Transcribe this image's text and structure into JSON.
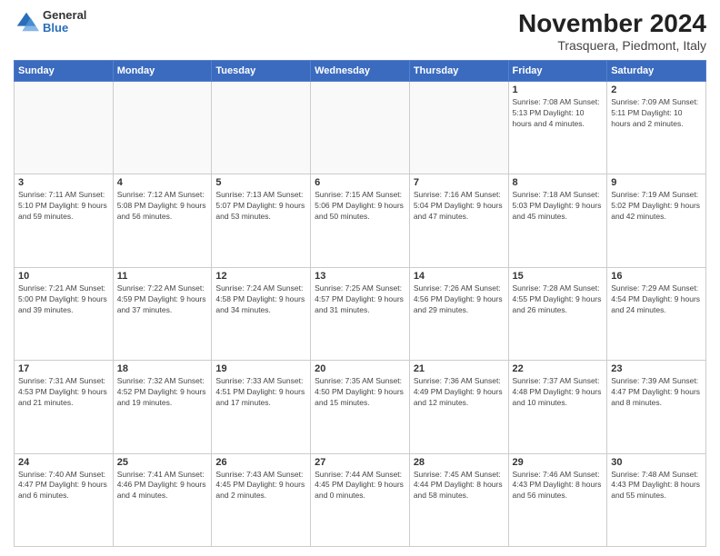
{
  "logo": {
    "general": "General",
    "blue": "Blue"
  },
  "title": "November 2024",
  "subtitle": "Trasquera, Piedmont, Italy",
  "days_of_week": [
    "Sunday",
    "Monday",
    "Tuesday",
    "Wednesday",
    "Thursday",
    "Friday",
    "Saturday"
  ],
  "weeks": [
    [
      {
        "day": "",
        "info": ""
      },
      {
        "day": "",
        "info": ""
      },
      {
        "day": "",
        "info": ""
      },
      {
        "day": "",
        "info": ""
      },
      {
        "day": "",
        "info": ""
      },
      {
        "day": "1",
        "info": "Sunrise: 7:08 AM\nSunset: 5:13 PM\nDaylight: 10 hours\nand 4 minutes."
      },
      {
        "day": "2",
        "info": "Sunrise: 7:09 AM\nSunset: 5:11 PM\nDaylight: 10 hours\nand 2 minutes."
      }
    ],
    [
      {
        "day": "3",
        "info": "Sunrise: 7:11 AM\nSunset: 5:10 PM\nDaylight: 9 hours\nand 59 minutes."
      },
      {
        "day": "4",
        "info": "Sunrise: 7:12 AM\nSunset: 5:08 PM\nDaylight: 9 hours\nand 56 minutes."
      },
      {
        "day": "5",
        "info": "Sunrise: 7:13 AM\nSunset: 5:07 PM\nDaylight: 9 hours\nand 53 minutes."
      },
      {
        "day": "6",
        "info": "Sunrise: 7:15 AM\nSunset: 5:06 PM\nDaylight: 9 hours\nand 50 minutes."
      },
      {
        "day": "7",
        "info": "Sunrise: 7:16 AM\nSunset: 5:04 PM\nDaylight: 9 hours\nand 47 minutes."
      },
      {
        "day": "8",
        "info": "Sunrise: 7:18 AM\nSunset: 5:03 PM\nDaylight: 9 hours\nand 45 minutes."
      },
      {
        "day": "9",
        "info": "Sunrise: 7:19 AM\nSunset: 5:02 PM\nDaylight: 9 hours\nand 42 minutes."
      }
    ],
    [
      {
        "day": "10",
        "info": "Sunrise: 7:21 AM\nSunset: 5:00 PM\nDaylight: 9 hours\nand 39 minutes."
      },
      {
        "day": "11",
        "info": "Sunrise: 7:22 AM\nSunset: 4:59 PM\nDaylight: 9 hours\nand 37 minutes."
      },
      {
        "day": "12",
        "info": "Sunrise: 7:24 AM\nSunset: 4:58 PM\nDaylight: 9 hours\nand 34 minutes."
      },
      {
        "day": "13",
        "info": "Sunrise: 7:25 AM\nSunset: 4:57 PM\nDaylight: 9 hours\nand 31 minutes."
      },
      {
        "day": "14",
        "info": "Sunrise: 7:26 AM\nSunset: 4:56 PM\nDaylight: 9 hours\nand 29 minutes."
      },
      {
        "day": "15",
        "info": "Sunrise: 7:28 AM\nSunset: 4:55 PM\nDaylight: 9 hours\nand 26 minutes."
      },
      {
        "day": "16",
        "info": "Sunrise: 7:29 AM\nSunset: 4:54 PM\nDaylight: 9 hours\nand 24 minutes."
      }
    ],
    [
      {
        "day": "17",
        "info": "Sunrise: 7:31 AM\nSunset: 4:53 PM\nDaylight: 9 hours\nand 21 minutes."
      },
      {
        "day": "18",
        "info": "Sunrise: 7:32 AM\nSunset: 4:52 PM\nDaylight: 9 hours\nand 19 minutes."
      },
      {
        "day": "19",
        "info": "Sunrise: 7:33 AM\nSunset: 4:51 PM\nDaylight: 9 hours\nand 17 minutes."
      },
      {
        "day": "20",
        "info": "Sunrise: 7:35 AM\nSunset: 4:50 PM\nDaylight: 9 hours\nand 15 minutes."
      },
      {
        "day": "21",
        "info": "Sunrise: 7:36 AM\nSunset: 4:49 PM\nDaylight: 9 hours\nand 12 minutes."
      },
      {
        "day": "22",
        "info": "Sunrise: 7:37 AM\nSunset: 4:48 PM\nDaylight: 9 hours\nand 10 minutes."
      },
      {
        "day": "23",
        "info": "Sunrise: 7:39 AM\nSunset: 4:47 PM\nDaylight: 9 hours\nand 8 minutes."
      }
    ],
    [
      {
        "day": "24",
        "info": "Sunrise: 7:40 AM\nSunset: 4:47 PM\nDaylight: 9 hours\nand 6 minutes."
      },
      {
        "day": "25",
        "info": "Sunrise: 7:41 AM\nSunset: 4:46 PM\nDaylight: 9 hours\nand 4 minutes."
      },
      {
        "day": "26",
        "info": "Sunrise: 7:43 AM\nSunset: 4:45 PM\nDaylight: 9 hours\nand 2 minutes."
      },
      {
        "day": "27",
        "info": "Sunrise: 7:44 AM\nSunset: 4:45 PM\nDaylight: 9 hours\nand 0 minutes."
      },
      {
        "day": "28",
        "info": "Sunrise: 7:45 AM\nSunset: 4:44 PM\nDaylight: 8 hours\nand 58 minutes."
      },
      {
        "day": "29",
        "info": "Sunrise: 7:46 AM\nSunset: 4:43 PM\nDaylight: 8 hours\nand 56 minutes."
      },
      {
        "day": "30",
        "info": "Sunrise: 7:48 AM\nSunset: 4:43 PM\nDaylight: 8 hours\nand 55 minutes."
      }
    ]
  ]
}
